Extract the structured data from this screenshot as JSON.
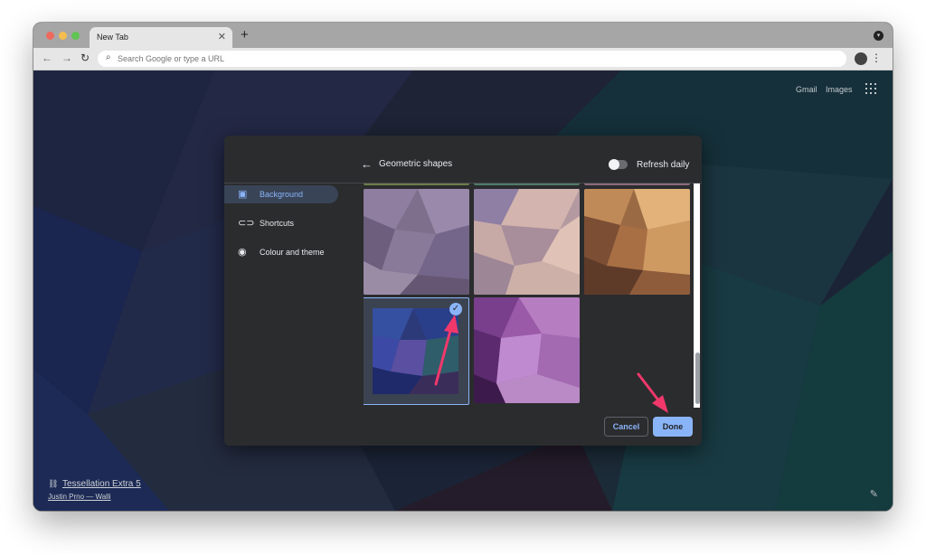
{
  "browser": {
    "tab_title": "New Tab",
    "tab_close": "✕",
    "new_tab": "+",
    "address_placeholder": "Search Google or type a URL"
  },
  "ntp": {
    "gmail_link": "Gmail",
    "images_link": "Images",
    "attribution_title": "Tessellation Extra 5",
    "attribution_author": "Justin Prno — Walli"
  },
  "dialog": {
    "back_icon": "←",
    "collection_title": "Geometric shapes",
    "refresh_label": "Refresh daily",
    "refresh_on": false,
    "menu": [
      {
        "label": "Background",
        "icon": "background-icon",
        "active": true
      },
      {
        "label": "Shortcuts",
        "icon": "link-icon",
        "active": false
      },
      {
        "label": "Colour and theme",
        "icon": "palette-icon",
        "active": false
      }
    ],
    "selected_tile": 4,
    "cancel_label": "Cancel",
    "done_label": "Done"
  },
  "colors": {
    "accent": "#8ab4f8",
    "dialog_bg": "#2b2c2e",
    "annotation_arrow": "#f0386b"
  }
}
